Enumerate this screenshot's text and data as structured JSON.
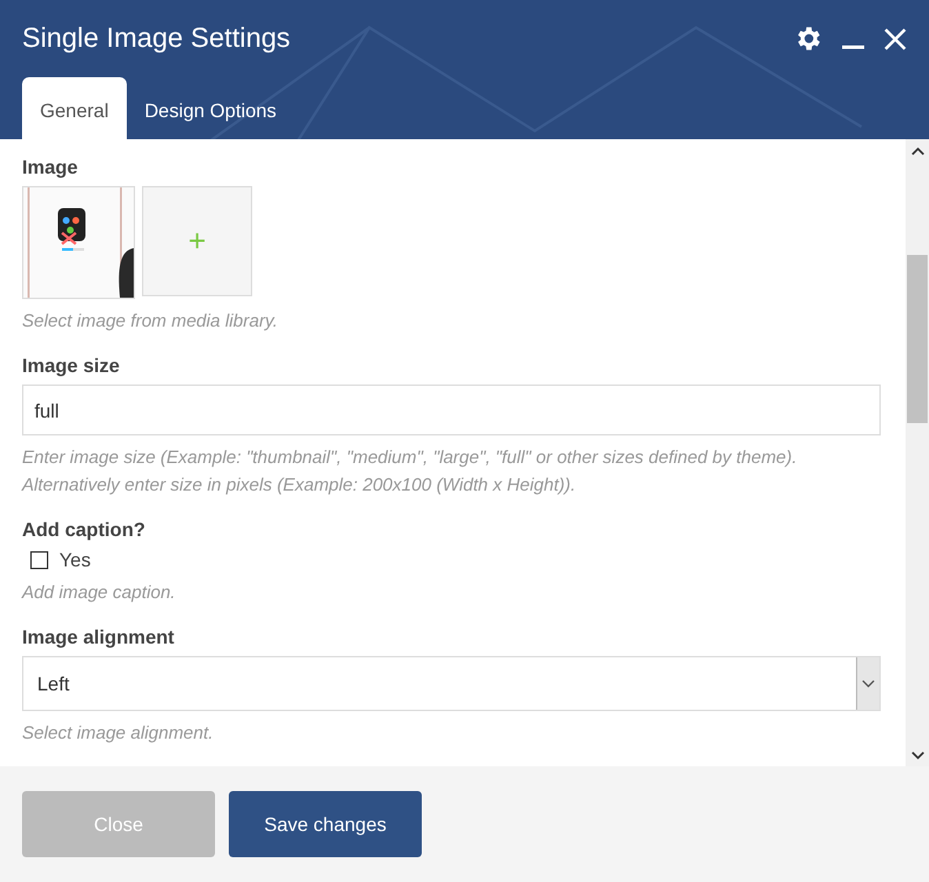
{
  "window": {
    "title": "Single Image Settings"
  },
  "tabs": [
    {
      "label": "General",
      "selected": true
    },
    {
      "label": "Design Options",
      "selected": false
    }
  ],
  "fields": [
    {
      "kind": "images",
      "label": "Image",
      "add_symbol": "+",
      "help": "Select image from media library."
    },
    {
      "kind": "text",
      "label": "Image size",
      "value": "full",
      "help": "Enter image size (Example: \"thumbnail\", \"medium\", \"large\", \"full\" or other sizes defined by theme). Alternatively enter size in pixels (Example: 200x100 (Width x Height))."
    },
    {
      "kind": "checkbox",
      "label": "Add caption?",
      "option": "Yes",
      "checked": false,
      "help": "Add image caption."
    },
    {
      "kind": "select",
      "label": "Image alignment",
      "value": "Left",
      "help": "Select image alignment."
    }
  ],
  "buttons": [
    {
      "label": "Close",
      "kind": "secondary"
    },
    {
      "label": "Save changes",
      "kind": "primary"
    }
  ]
}
